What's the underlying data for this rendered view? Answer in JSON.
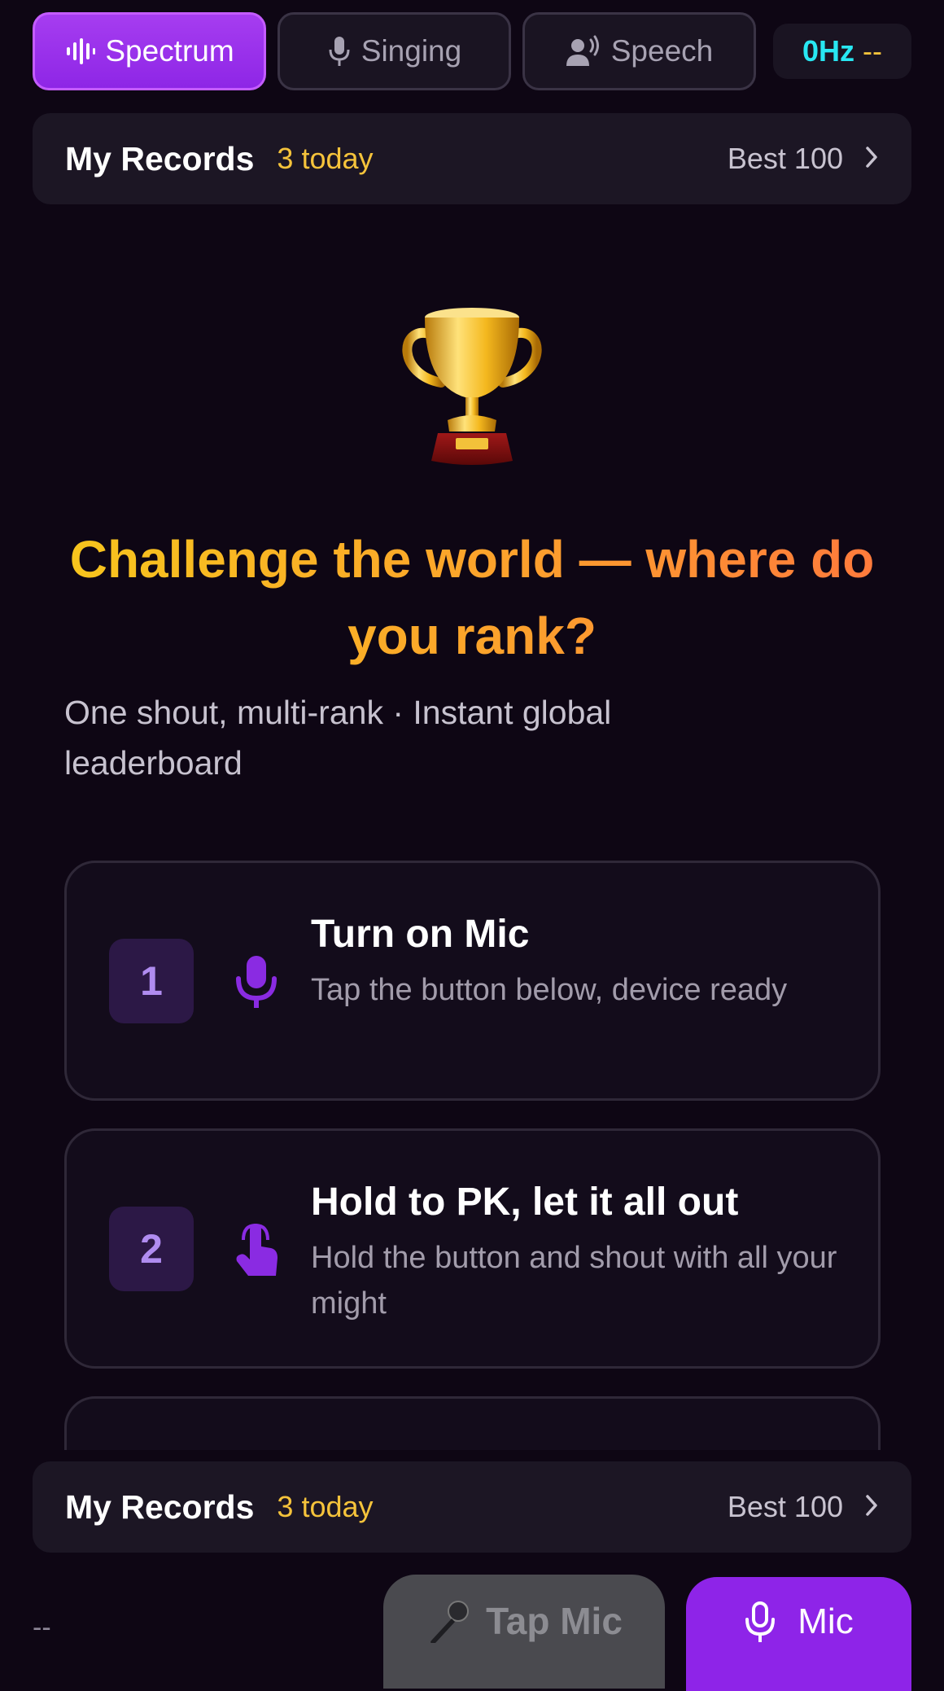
{
  "tabs": [
    {
      "label": "Spectrum",
      "icon": "waveform-icon",
      "active": true
    },
    {
      "label": "Singing",
      "icon": "microphone-icon",
      "active": false
    },
    {
      "label": "Speech",
      "icon": "speaking-person-icon",
      "active": false
    }
  ],
  "frequency": {
    "value": "0Hz",
    "note": "--"
  },
  "records": {
    "title": "My Records",
    "today": "3 today",
    "best": "Best 100"
  },
  "hero": {
    "icon": "trophy-icon",
    "headline": "Challenge the world — where do you rank?",
    "subline": "One shout, multi-rank · Instant global leaderboard"
  },
  "steps": [
    {
      "number": "1",
      "icon": "microphone-icon",
      "title": "Turn on Mic",
      "description": "Tap the button below, device ready"
    },
    {
      "number": "2",
      "icon": "hand-tap-icon",
      "title": "Hold to PK, let it all out",
      "description": "Hold the button and shout with all your might"
    }
  ],
  "bottom": {
    "status": "--",
    "tap_mic_label": "Tap Mic",
    "mic_label": "Mic"
  },
  "colors": {
    "background": "#0e0614",
    "accent": "#8e24e8",
    "gold": "#f5c33b",
    "cyan": "#28e7f2"
  }
}
